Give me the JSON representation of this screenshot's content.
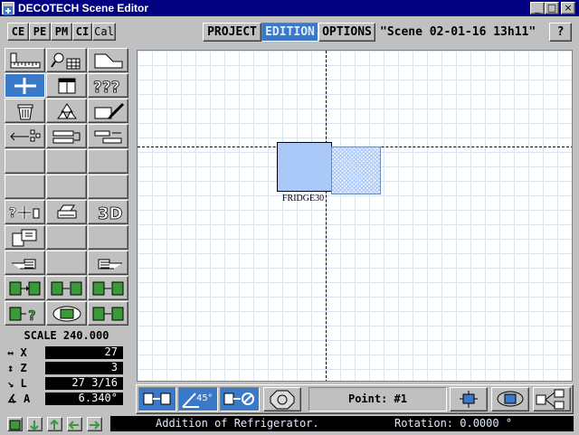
{
  "window": {
    "title": "DECOTECH Scene Editor",
    "controls": {
      "minimize": "_",
      "maximize": "□",
      "close": "×"
    }
  },
  "modules": [
    "CE",
    "PE",
    "PM",
    "CI",
    "Cal"
  ],
  "tabs": {
    "project": "PROJECT",
    "edition": "EDITION",
    "options": "OPTIONS",
    "active": "EDITION"
  },
  "scene": {
    "name": "\"Scene 02-01-16 13h11\"",
    "help": "?"
  },
  "toolbox": {
    "icons": [
      "ruler-icon",
      "magnify-grid-icon",
      "room-shape-icon",
      "add-cross-icon",
      "cabinet-icon",
      "question-marks-icon",
      "trash-icon",
      "recycle-icon",
      "paint-icon",
      "align-icon",
      "replace-icon",
      "swap-icon",
      "add-objects-icon",
      "printer-icon",
      "3d-icon",
      "copy-icon",
      "hand-left-icon",
      "hand-right-icon",
      "group-move-icon",
      "group-move-icon",
      "group-move-icon",
      "group-query-icon",
      "view-toggle-icon",
      "group-move-icon"
    ],
    "three_d_label": "3D"
  },
  "scale": {
    "label": "SCALE 240.000"
  },
  "coords": {
    "x": {
      "label": "X",
      "value": "27"
    },
    "z": {
      "label": "Z",
      "value": "3"
    },
    "l": {
      "label": "L",
      "value": "27 3/16"
    },
    "a": {
      "label": "A",
      "value": "6.340°"
    }
  },
  "canvas": {
    "object_label": "FRIDGE30"
  },
  "bottom": {
    "angle_label": "45°",
    "point_label": "Point: #1"
  },
  "status": {
    "message": "Addition of Refrigerator.",
    "rotation": "Rotation: 0.0000 °"
  },
  "colors": {
    "title_bar": "#000080",
    "accent": "#3a78c8",
    "object": "#aac8f8"
  }
}
